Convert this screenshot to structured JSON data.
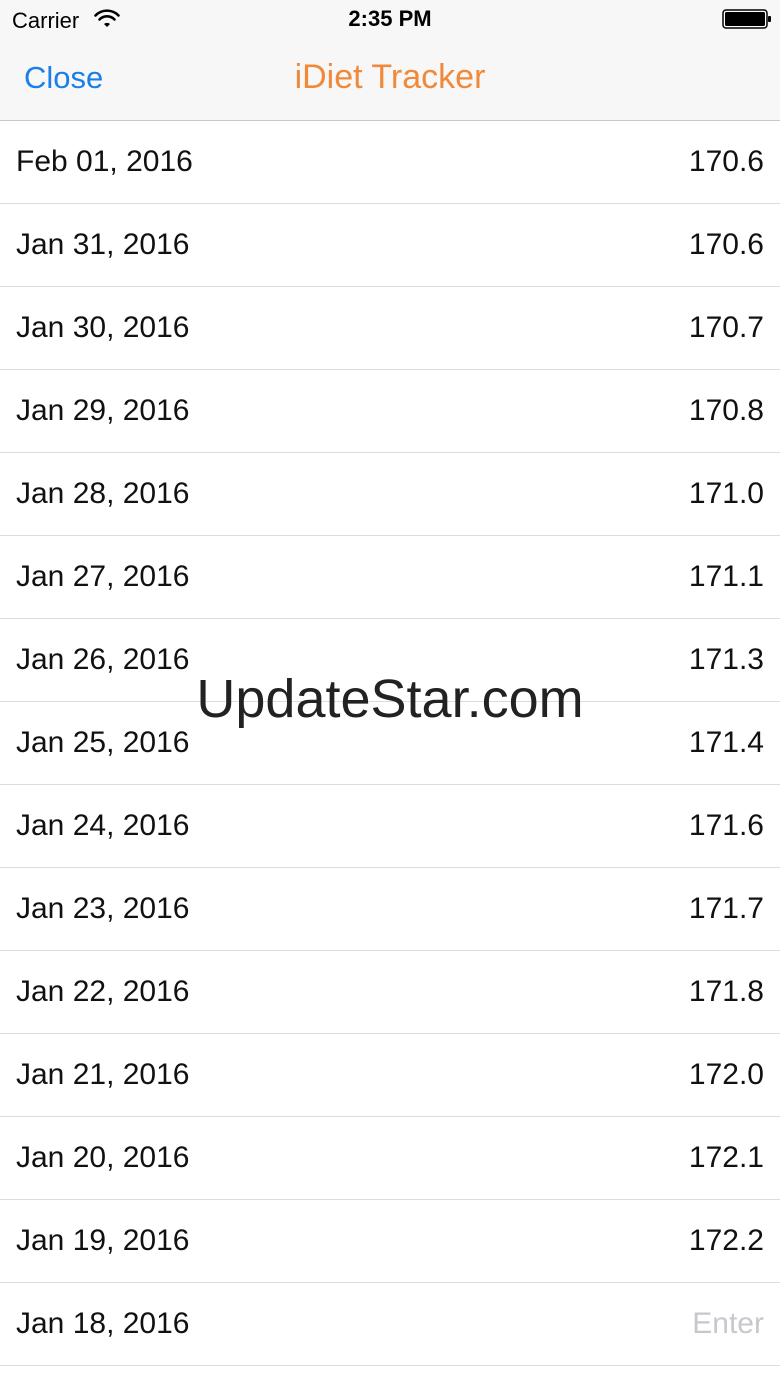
{
  "status_bar": {
    "carrier": "Carrier",
    "time": "2:35 PM",
    "wifi_icon": "wifi-icon",
    "battery_icon": "battery-icon"
  },
  "nav": {
    "close_label": "Close",
    "title": "iDiet Tracker",
    "title_color": "#f08a3a",
    "close_color": "#1a7fe6"
  },
  "rows": [
    {
      "date": "Feb 01, 2016",
      "value": "170.6"
    },
    {
      "date": "Jan 31, 2016",
      "value": "170.6"
    },
    {
      "date": "Jan 30, 2016",
      "value": "170.7"
    },
    {
      "date": "Jan 29, 2016",
      "value": "170.8"
    },
    {
      "date": "Jan 28, 2016",
      "value": "171.0"
    },
    {
      "date": "Jan 27, 2016",
      "value": "171.1"
    },
    {
      "date": "Jan 26, 2016",
      "value": "171.3"
    },
    {
      "date": "Jan 25, 2016",
      "value": "171.4"
    },
    {
      "date": "Jan 24, 2016",
      "value": "171.6"
    },
    {
      "date": "Jan 23, 2016",
      "value": "171.7"
    },
    {
      "date": "Jan 22, 2016",
      "value": "171.8"
    },
    {
      "date": "Jan 21, 2016",
      "value": "172.0"
    },
    {
      "date": "Jan 20, 2016",
      "value": "172.1"
    },
    {
      "date": "Jan 19, 2016",
      "value": "172.2"
    },
    {
      "date": "Jan 18, 2016",
      "value": "",
      "placeholder": "Enter"
    }
  ],
  "watermark": "UpdateStar.com"
}
